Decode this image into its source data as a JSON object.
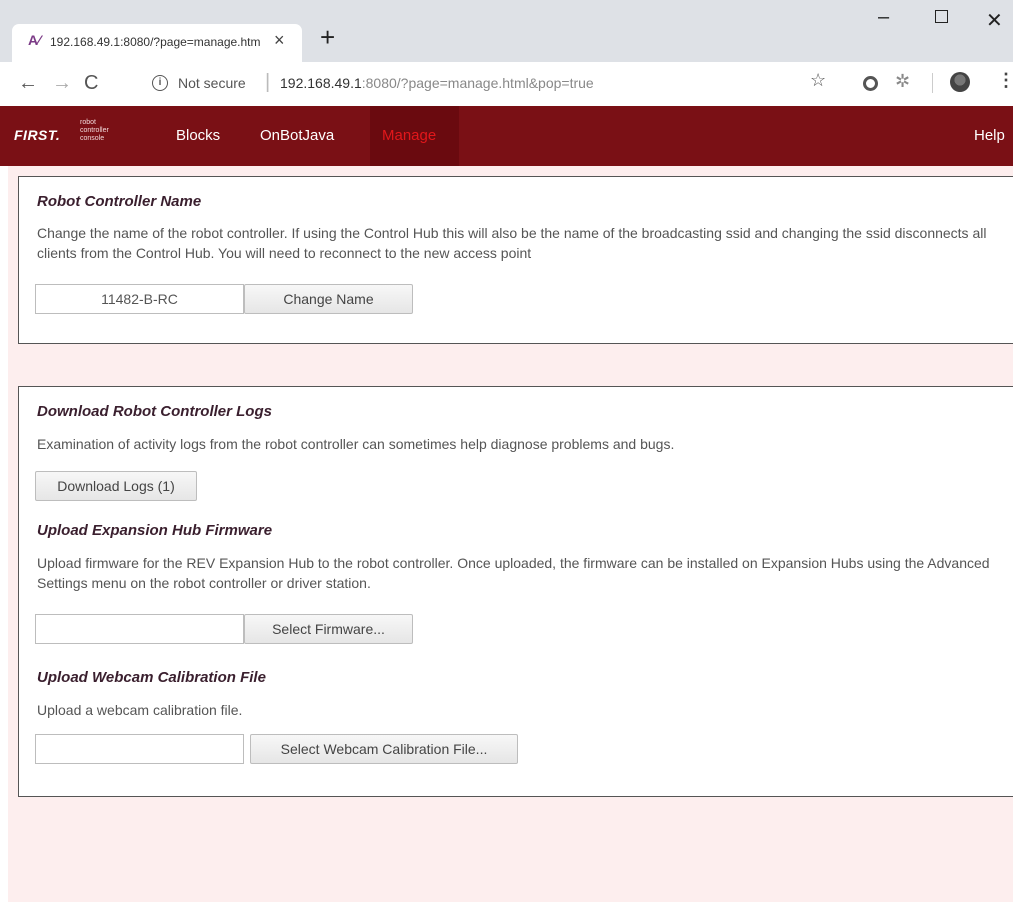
{
  "browser": {
    "tab_title": "192.168.49.1:8080/?page=manage.html&pop=true",
    "tab_icon": "first-favicon",
    "new_tab_label": "+",
    "security_label": "Not secure",
    "url_host": "192.168.49.1",
    "url_rest": ":8080/?page=manage.html&pop=true"
  },
  "appbar": {
    "brand_main": "FIRST.",
    "brand_sub": [
      "robot",
      "controller",
      "console"
    ],
    "links": [
      "Blocks",
      "OnBotJava",
      "Manage"
    ],
    "active": "Manage",
    "help": "Help",
    "colors": {
      "bar": "#7a1015",
      "active_bg": "#6a0a0f",
      "active_text": "#e2171b"
    }
  },
  "rc_name": {
    "title": "Robot Controller Name",
    "description": "Change the name of the robot controller. If using the Control Hub this will also be the name of the broadcasting ssid and changing the ssid disconnects all clients from the Control Hub. You will need to reconnect to the new access point",
    "name_value": "11482-B-RC",
    "button": "Change Name"
  },
  "logs": {
    "title": "Download Robot Controller Logs",
    "description": "Examination of activity logs from the robot controller can sometimes help diagnose problems and bugs.",
    "button": "Download Logs (1)"
  },
  "firmware": {
    "title": "Upload Expansion Hub Firmware",
    "description": "Upload firmware for the REV Expansion Hub to the robot controller. Once uploaded, the firmware can be installed on Expansion Hubs using the Advanced Settings menu on the robot controller or driver station.",
    "file_value": "",
    "button": "Select Firmware..."
  },
  "webcam": {
    "title": "Upload Webcam Calibration File",
    "description": "Upload a webcam calibration file.",
    "file_value": "",
    "button": "Select Webcam Calibration File..."
  }
}
